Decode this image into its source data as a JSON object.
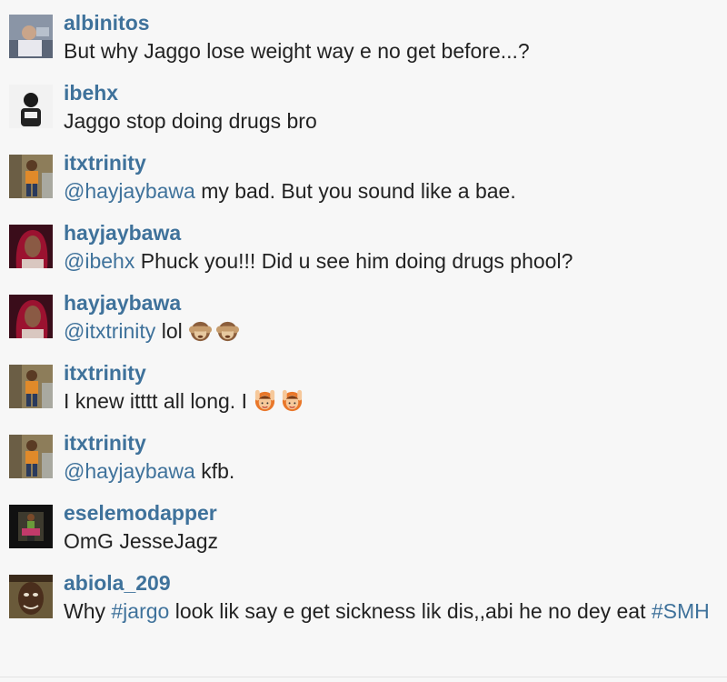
{
  "comments": [
    {
      "username": "albinitos",
      "avatar_icon": "avatar-albinitos-icon",
      "parts": [
        {
          "type": "text",
          "value": "But why Jaggo lose weight way e no get before...?"
        }
      ]
    },
    {
      "username": "ibehx",
      "avatar_icon": "avatar-ibehx-icon",
      "parts": [
        {
          "type": "text",
          "value": "Jaggo stop doing drugs bro"
        }
      ]
    },
    {
      "username": "itxtrinity",
      "avatar_icon": "avatar-itxtrinity-icon",
      "parts": [
        {
          "type": "mention",
          "value": "@hayjaybawa"
        },
        {
          "type": "text",
          "value": " my bad. But you sound like a bae."
        }
      ]
    },
    {
      "username": "hayjaybawa",
      "avatar_icon": "avatar-hayjaybawa-icon",
      "parts": [
        {
          "type": "mention",
          "value": "@ibehx"
        },
        {
          "type": "text",
          "value": " Phuck you!!! Did u see him doing drugs phool?"
        }
      ]
    },
    {
      "username": "hayjaybawa",
      "avatar_icon": "avatar-hayjaybawa-icon",
      "parts": [
        {
          "type": "mention",
          "value": "@itxtrinity"
        },
        {
          "type": "text",
          "value": " lol "
        },
        {
          "type": "emoji",
          "value": "see-no-evil-monkey"
        },
        {
          "type": "emoji",
          "value": "see-no-evil-monkey"
        }
      ]
    },
    {
      "username": "itxtrinity",
      "avatar_icon": "avatar-itxtrinity-icon",
      "parts": [
        {
          "type": "text",
          "value": "I knew itttt all long. I "
        },
        {
          "type": "emoji",
          "value": "raising-hands-person"
        },
        {
          "type": "emoji",
          "value": "raising-hands-person"
        }
      ]
    },
    {
      "username": "itxtrinity",
      "avatar_icon": "avatar-itxtrinity-icon",
      "parts": [
        {
          "type": "mention",
          "value": "@hayjaybawa"
        },
        {
          "type": "text",
          "value": " kfb."
        }
      ]
    },
    {
      "username": "eselemodapper",
      "avatar_icon": "avatar-eselemodapper-icon",
      "parts": [
        {
          "type": "text",
          "value": "OmG JesseJagz"
        }
      ]
    },
    {
      "username": "abiola_209",
      "avatar_icon": "avatar-abiola-209-icon",
      "parts": [
        {
          "type": "text",
          "value": "Why "
        },
        {
          "type": "hashtag",
          "value": "#jargo"
        },
        {
          "type": "text",
          "value": " look lik say e get sickness lik dis,,abi he no dey eat "
        },
        {
          "type": "hashtag",
          "value": "#SMH"
        }
      ]
    }
  ],
  "colors": {
    "username": "#3f729b",
    "link": "#3f729b",
    "text": "#222222",
    "background": "#f7f7f7"
  }
}
